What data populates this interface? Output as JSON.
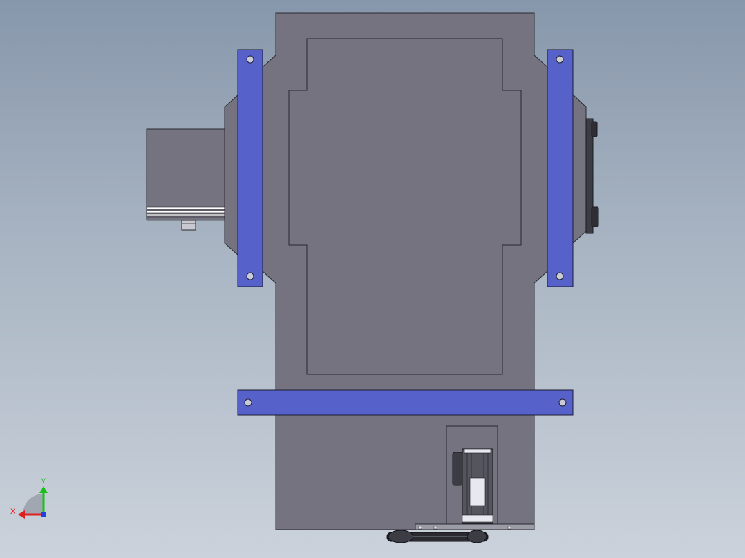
{
  "viewport": {
    "background_top": "#8797ab",
    "background_bottom": "#cbd2db"
  },
  "model": {
    "body_color": "#74737f",
    "edge_color": "#2a2a30",
    "bracket_color": "#5661c9",
    "dark_part_color": "#3c3c44"
  },
  "triad": {
    "x_label": "X",
    "y_label": "Y",
    "x_color": "#e02020",
    "y_color": "#18c018",
    "z_color": "#2040e0"
  }
}
